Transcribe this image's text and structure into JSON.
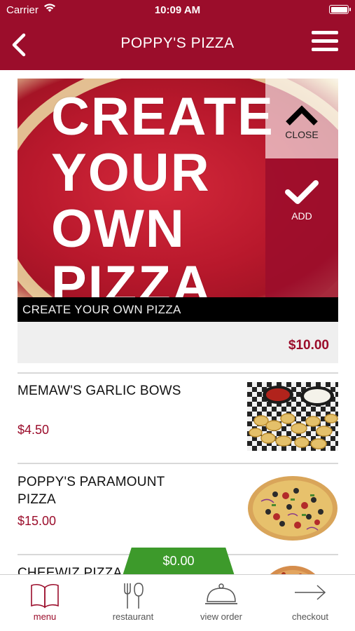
{
  "status_bar": {
    "carrier": "Carrier",
    "time": "10:09 AM"
  },
  "nav": {
    "title": "POPPY'S PIZZA",
    "icons": {
      "back": "chevron-left-icon",
      "menu": "hamburger-menu-icon"
    }
  },
  "feature": {
    "image_text_lines": [
      "CREATE",
      "YOUR",
      "OWN",
      "PIZZA"
    ],
    "close_label": "CLOSE",
    "add_label": "ADD",
    "caption": "CREATE YOUR OWN PIZZA",
    "price": "$10.00"
  },
  "items": [
    {
      "name": "MEMAW'S GARLIC BOWS",
      "price": "$4.50"
    },
    {
      "name": "POPPY'S PARAMOUNT PIZZA",
      "price": "$15.00"
    },
    {
      "name": "CHEEWIZ PIZZA",
      "price": ""
    }
  ],
  "cart": {
    "total": "$0.00"
  },
  "tabbar": {
    "tabs": [
      {
        "label": "menu",
        "icon": "book-icon",
        "active": true
      },
      {
        "label": "restaurant",
        "icon": "fork-knife-icon",
        "active": false
      },
      {
        "label": "view order",
        "icon": "cloche-icon",
        "active": false
      },
      {
        "label": "checkout",
        "icon": "arrow-right-icon",
        "active": false
      }
    ]
  },
  "colors": {
    "brand": "#9b0d2b",
    "cart_green": "#3d9a2b"
  }
}
